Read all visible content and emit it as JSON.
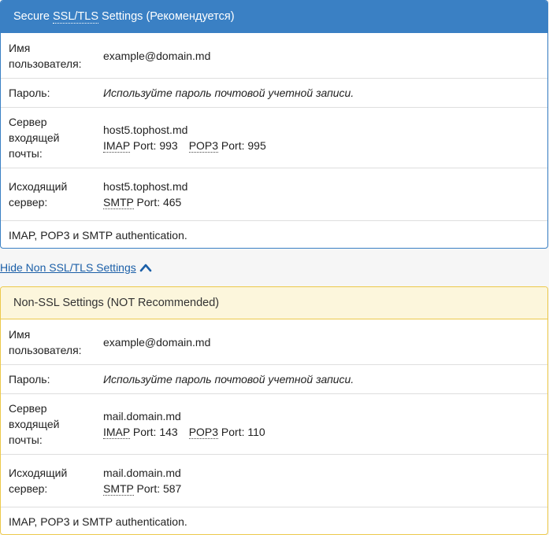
{
  "ssl": {
    "title_prefix": "Secure ",
    "title_abbr": "SSL/TLS",
    "title_suffix": " Settings (Рекомендуется)",
    "username_label_1": "Имя",
    "username_label_2": "пользователя:",
    "username_value": "example@domain.md",
    "password_label": "Пароль:",
    "password_value": "Используйте пароль почтовой учетной записи.",
    "incoming_label_1": "Сервер",
    "incoming_label_2": "входящей",
    "incoming_label_3": "почты:",
    "incoming_host": "host5.tophost.md",
    "imap_abbr": "IMAP",
    "imap_port": " Port: 993",
    "pop3_abbr": "POP3",
    "pop3_port": " Port: 995",
    "outgoing_label_1": "Исходящий",
    "outgoing_label_2": "сервер:",
    "outgoing_host": "host5.tophost.md",
    "smtp_abbr": "SMTP",
    "smtp_port": " Port: 465",
    "auth_text": "IMAP, POP3 и SMTP authentication."
  },
  "toggle": {
    "label": "Hide Non SSL/TLS Settings",
    "icon": "chevron-up-icon"
  },
  "nonssl": {
    "title": "Non-SSL Settings (NOT Recommended)",
    "username_label_1": "Имя",
    "username_label_2": "пользователя:",
    "username_value": "example@domain.md",
    "password_label": "Пароль:",
    "password_value": "Используйте пароль почтовой учетной записи.",
    "incoming_label_1": "Сервер",
    "incoming_label_2": "входящей",
    "incoming_label_3": "почты:",
    "incoming_host": "mail.domain.md",
    "imap_abbr": "IMAP",
    "imap_port": " Port: 143",
    "pop3_abbr": "POP3",
    "pop3_port": " Port: 110",
    "outgoing_label_1": "Исходящий",
    "outgoing_label_2": "сервер:",
    "outgoing_host": "mail.domain.md",
    "smtp_abbr": "SMTP",
    "smtp_port": " Port: 587",
    "auth_text": "IMAP, POP3 и SMTP authentication."
  },
  "colors": {
    "ssl_header": "#3a80c4",
    "nonssl_header_bg": "#fcf6dc",
    "nonssl_border": "#ecc94b",
    "link": "#1b5fa8"
  }
}
